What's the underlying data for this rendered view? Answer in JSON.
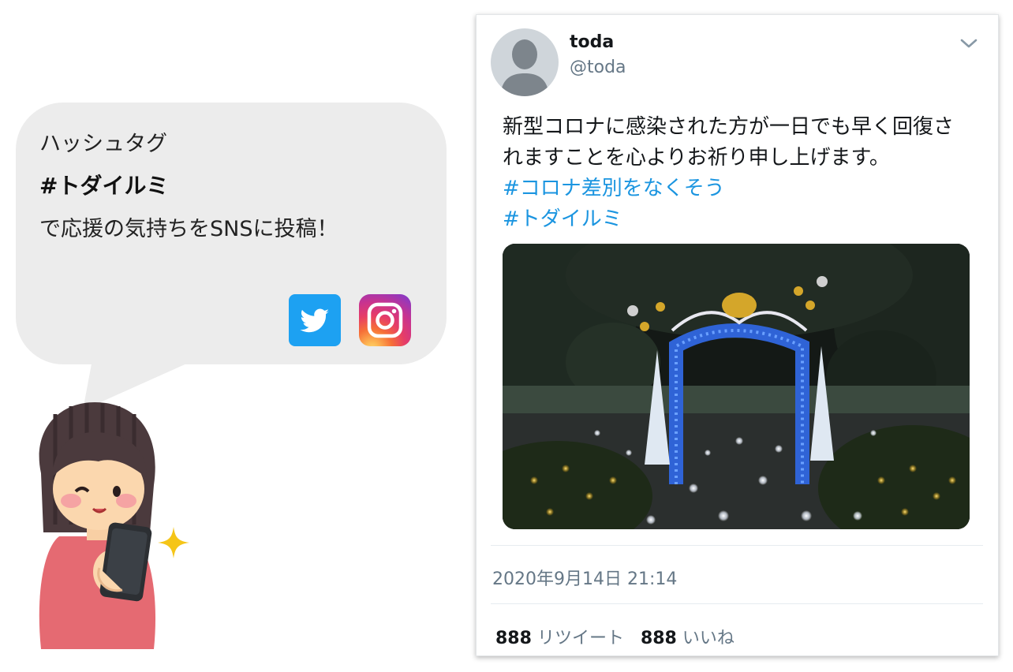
{
  "bubble": {
    "line1": "ハッシュタグ",
    "line2": "#トダイルミ",
    "line3": "で応援の気持ちをSNSに投稿！",
    "icons": [
      "twitter-icon",
      "instagram-icon"
    ]
  },
  "tweet": {
    "user_name": "toda",
    "user_handle": "@toda",
    "body_lines": [
      "新型コロナに感染された方が一日でも早く回復さ",
      "れますことを心よりお祈り申し上げます。"
    ],
    "hashtags": [
      "#コロナ差別をなくそう",
      "#トダイルミ"
    ],
    "timestamp": "2020年9月14日 21:14",
    "retweet_count": "888",
    "retweet_label": "リツイート",
    "like_count": "888",
    "like_label": "いいね"
  },
  "colors": {
    "hashtag": "#1b95e0",
    "bubble": "#ececec",
    "twitter": "#1da1f2"
  }
}
